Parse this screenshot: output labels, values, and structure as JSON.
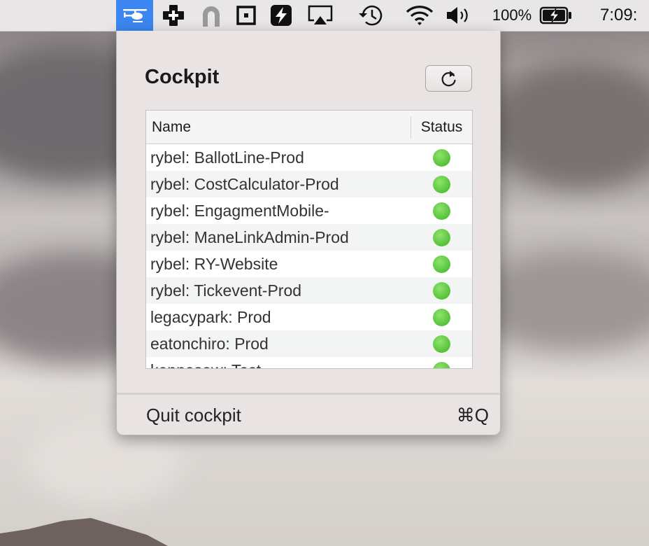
{
  "menubar": {
    "battery_percent": "100%",
    "clock": "7:09:",
    "icons": [
      "helicopter-icon",
      "plus-app-icon",
      "magnet-icon",
      "square-app-icon",
      "lightning-app-icon",
      "airplay-icon",
      "time-machine-icon",
      "wifi-icon",
      "volume-icon",
      "battery-charging-icon"
    ]
  },
  "popover": {
    "title": "Cockpit",
    "refresh_icon": "refresh-icon",
    "table": {
      "columns": [
        "Name",
        "Status"
      ],
      "rows": [
        {
          "name": "rybel: BallotLine-Prod",
          "status": "green"
        },
        {
          "name": "rybel: CostCalculator-Prod",
          "status": "green"
        },
        {
          "name": "rybel: EngagmentMobile-",
          "status": "green"
        },
        {
          "name": "rybel: ManeLinkAdmin-Prod",
          "status": "green"
        },
        {
          "name": "rybel: RY-Website",
          "status": "green"
        },
        {
          "name": "rybel: Tickevent-Prod",
          "status": "green"
        },
        {
          "name": "legacypark: Prod",
          "status": "green"
        },
        {
          "name": "eatonchiro: Prod",
          "status": "green"
        },
        {
          "name": "kennesaw: Test",
          "status": "green"
        }
      ]
    },
    "quit_label": "Quit cockpit",
    "quit_shortcut": "⌘Q"
  },
  "colors": {
    "menubar_active": "#3b86f0",
    "status_green": "#55c23a",
    "popover_bg": "#e9e3e3"
  }
}
